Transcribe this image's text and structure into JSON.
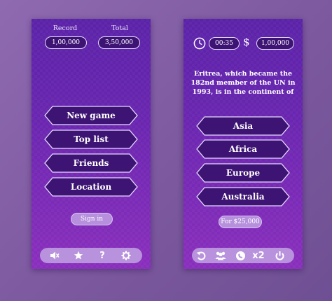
{
  "home": {
    "record_label": "Record",
    "record_value": "1,00,000",
    "total_label": "Total",
    "total_value": "3,50,000",
    "menu": [
      {
        "label": "New game"
      },
      {
        "label": "Top list"
      },
      {
        "label": "Friends"
      },
      {
        "label": "Location"
      }
    ],
    "sign_in_label": "Sign in",
    "bottom_icons": [
      "mute-icon",
      "star-icon",
      "help-icon",
      "settings-icon"
    ],
    "help_glyph": "?"
  },
  "game": {
    "timer": "00:35",
    "currency_symbol": "$",
    "prize": "1,00,000",
    "question": "Eritrea, which became the 182nd member of the UN in 1993, is in the continent of",
    "answers": [
      {
        "label": "Asia"
      },
      {
        "label": "Africa"
      },
      {
        "label": "Europe"
      },
      {
        "label": "Australia"
      }
    ],
    "take_money_label": "For $25,000",
    "lifelines": [
      "undo-icon",
      "audience-icon",
      "phone-icon",
      "double-icon",
      "power-icon"
    ],
    "double_label": "x2"
  },
  "colors": {
    "panel_top": "#5b23a8",
    "panel_bottom": "#8a2fbd",
    "button_fill": "#3d1473",
    "button_border": "#e7dcff",
    "accent_pill": "#b892dc",
    "background": "#8a65ad"
  }
}
